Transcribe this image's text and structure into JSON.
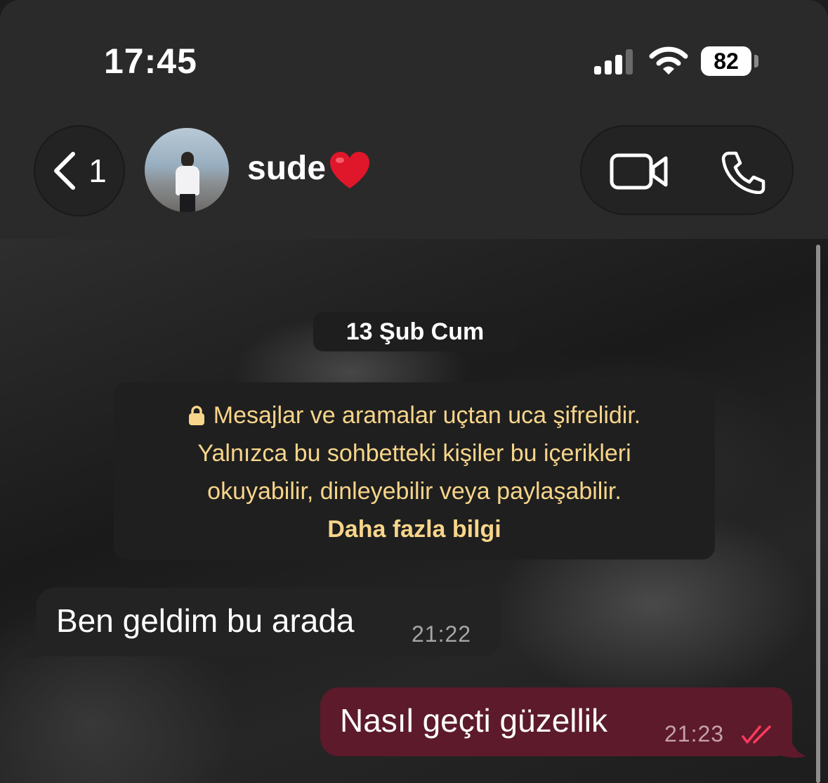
{
  "status_bar": {
    "time": "17:45",
    "battery": "82"
  },
  "header": {
    "back_count": "1",
    "contact_name": "sude",
    "name_emoji": "heart-icon"
  },
  "chat": {
    "date_chip": "13 Şub Cum",
    "encryption": {
      "line1": "Mesajlar ve aramalar uçtan uca şifrelidir.",
      "line2": "Yalnızca bu sohbetteki kişiler bu içerikleri",
      "line3": "okuyabilir, dinleyebilir veya paylaşabilir.",
      "more": "Daha fazla bilgi"
    },
    "messages": [
      {
        "direction": "incoming",
        "text": "Ben geldim bu arada",
        "time": "21:22"
      },
      {
        "direction": "outgoing",
        "text": "Nasıl geçti güzellik",
        "time": "21:23",
        "status": "read"
      }
    ]
  },
  "colors": {
    "accent_yellow": "#f7d58a",
    "outgoing_bubble": "#5c1a2b",
    "incoming_bubble": "#232323",
    "read_ticks": "#ff3b5c"
  }
}
